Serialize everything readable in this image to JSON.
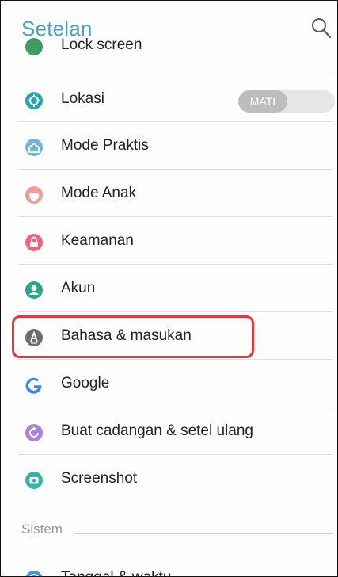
{
  "header": {
    "title": "Setelan",
    "search_icon": "search-icon"
  },
  "colors": {
    "title": "#4a9fc8",
    "highlight": "#e8363c",
    "lokasi": "#26a6b4",
    "mode_praktis": "#6fb7d8",
    "mode_anak": "#f39a9c",
    "keamanan": "#f0637a",
    "akun": "#2da68a",
    "bahasa": "#6d6d6d",
    "google": "#3b87f1",
    "backup": "#a983d8",
    "screenshot": "#2db6a8",
    "tanggal": "#3b9ad8"
  },
  "items": [
    {
      "label": "Lock screen",
      "icon": "lock-screen-icon"
    },
    {
      "label": "Lokasi",
      "icon": "location-icon",
      "toggle": "MATI"
    },
    {
      "label": "Mode Praktis",
      "icon": "home-icon"
    },
    {
      "label": "Mode Anak",
      "icon": "kid-face-icon"
    },
    {
      "label": "Keamanan",
      "icon": "lock-icon"
    },
    {
      "label": "Akun",
      "icon": "account-icon"
    },
    {
      "label": "Bahasa & masukan",
      "icon": "language-icon",
      "highlighted": true
    },
    {
      "label": "Google",
      "icon": "google-icon"
    },
    {
      "label": "Buat cadangan & setel ulang",
      "icon": "backup-icon"
    },
    {
      "label": "Screenshot",
      "icon": "screenshot-icon"
    }
  ],
  "section": {
    "label": "Sistem"
  },
  "system_items": [
    {
      "label": "Tanggal & waktu",
      "icon": "clock-icon"
    }
  ]
}
